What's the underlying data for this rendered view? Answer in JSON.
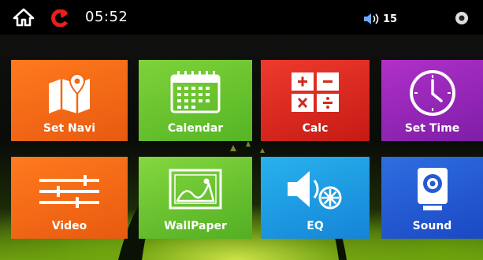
{
  "status_bar": {
    "time": "05:52",
    "volume_level": "15",
    "icons": [
      "home-icon",
      "back-icon",
      "volume-icon",
      "settings-icon"
    ]
  },
  "tiles": [
    {
      "label": "Set Navi",
      "icon": "map-icon",
      "color": "#f26a18"
    },
    {
      "label": "Calendar",
      "icon": "calendar-icon",
      "color": "#66c22e"
    },
    {
      "label": "Calc",
      "icon": "calculator-icon",
      "color": "#d82a20"
    },
    {
      "label": "Set Time",
      "icon": "clock-icon",
      "color": "#9726b8"
    },
    {
      "label": "Video",
      "icon": "sliders-icon",
      "color": "#f26a18"
    },
    {
      "label": "WallPaper",
      "icon": "picture-icon",
      "color": "#6ac42e"
    },
    {
      "label": "EQ",
      "icon": "speaker-eq-icon",
      "color": "#1e9ce2"
    },
    {
      "label": "Sound",
      "icon": "speaker-box-icon",
      "color": "#255ad2"
    }
  ]
}
